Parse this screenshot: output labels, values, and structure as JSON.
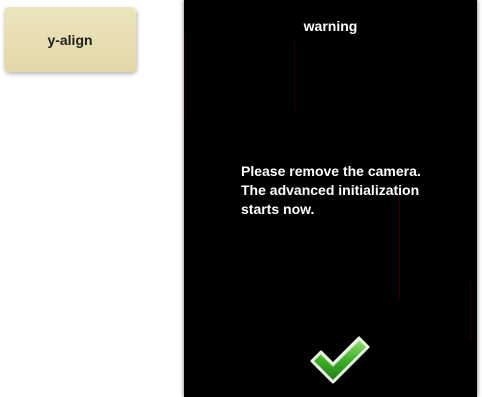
{
  "buttons": {
    "yalign_label": "y-align"
  },
  "dialog": {
    "title": "warning",
    "message": "Please remove the camera. The advanced initialization starts now.",
    "confirm_icon": "checkmark-icon"
  },
  "colors": {
    "button_bg": "#e6ddb0",
    "dialog_bg": "#000000",
    "text": "#ffffff",
    "check_green": "#3fae2a"
  }
}
